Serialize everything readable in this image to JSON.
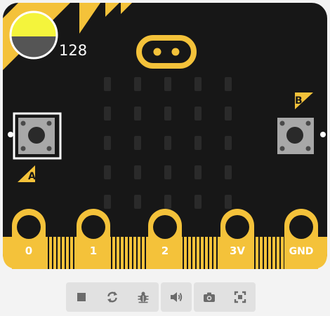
{
  "light_sensor": {
    "value": "128"
  },
  "buttons": {
    "a_label": "A",
    "b_label": "B"
  },
  "pins": [
    "0",
    "1",
    "2",
    "3V",
    "GND"
  ],
  "led_matrix": {
    "rows": 5,
    "cols": 5,
    "state": "all-off"
  },
  "colors": {
    "board": "#171717",
    "accent": "#f4c23a",
    "sensor_top": "#f4f43c",
    "sensor_bottom": "#555555",
    "led_off": "#2a2a2a",
    "toolbar": "#e1e1e1",
    "toolbar_icon": "#6b6b6b"
  },
  "toolbar": {
    "groups": [
      [
        "stop-icon",
        "restart-icon",
        "debug-icon"
      ],
      [
        "sound-icon"
      ],
      [
        "screenshot-icon",
        "fullscreen-icon"
      ]
    ]
  }
}
